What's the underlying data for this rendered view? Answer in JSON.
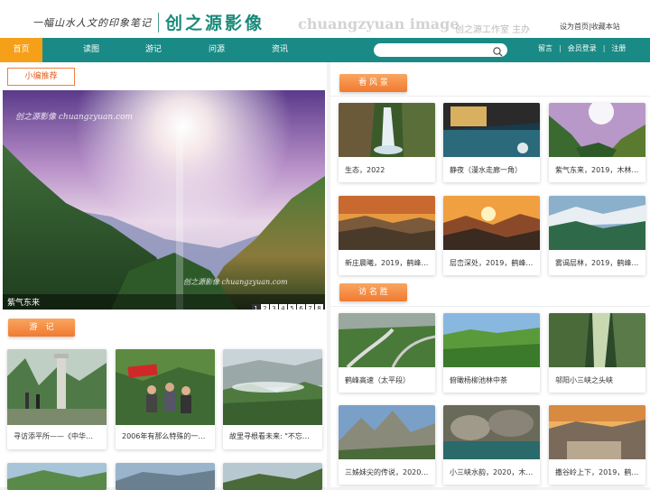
{
  "header": {
    "slogan": "一幅山水人文的印象笔记",
    "logo": "创之源影像",
    "latin_name": "chuangzyuan image",
    "studio": "创之源工作室 主办",
    "links": [
      "设为首页",
      "收藏本站"
    ],
    "link_sep": "|"
  },
  "nav": {
    "items": [
      "首页",
      "读图",
      "游记",
      "问源",
      "资讯"
    ],
    "search_placeholder": "",
    "right_links": [
      "留言",
      "会员登录",
      "注册"
    ],
    "sep": "|"
  },
  "left": {
    "recommend_label": "小编推荐",
    "hero": {
      "caption": "紫气东来",
      "pages": [
        "1",
        "2",
        "3",
        "4",
        "5",
        "6",
        "7",
        "8"
      ],
      "active_page": "1",
      "watermark_top": "创之源影像 chuangzyuan.com",
      "watermark_bottom": "创之源影像 chuangzyuan.com"
    },
    "travel_label": "游　记",
    "travel_cards": [
      "寻访添平所——《中华…",
      "2006年有那么特殊的一…",
      "故里寻根看未来: \"不忘…"
    ]
  },
  "right": {
    "scenery_label": "看 风 景",
    "scenery_cards": [
      "生态，2022",
      "静夜（漫水走廊一角）",
      "紫气东来，2019，木林…",
      "新庄晨曦，2019，鹤峰…",
      "层峦深处，2019，鹤峰…",
      "雾谒层林，2019，鹤峰…"
    ],
    "visit_label": "访 名 胜",
    "visit_cards": [
      "鹤峰高速（太平段）",
      "俯瞰杨柳池林中茶",
      "邬阳小三峡之头峡",
      "三姊妹尖的传说，2020…",
      "小三峡水韵，2020，木…",
      "撒谷岭上下，2019，鹤…"
    ]
  },
  "colors": {
    "teal": "#1a8a86",
    "orange": "#f6a01a",
    "logo": "#1a8a7a"
  }
}
